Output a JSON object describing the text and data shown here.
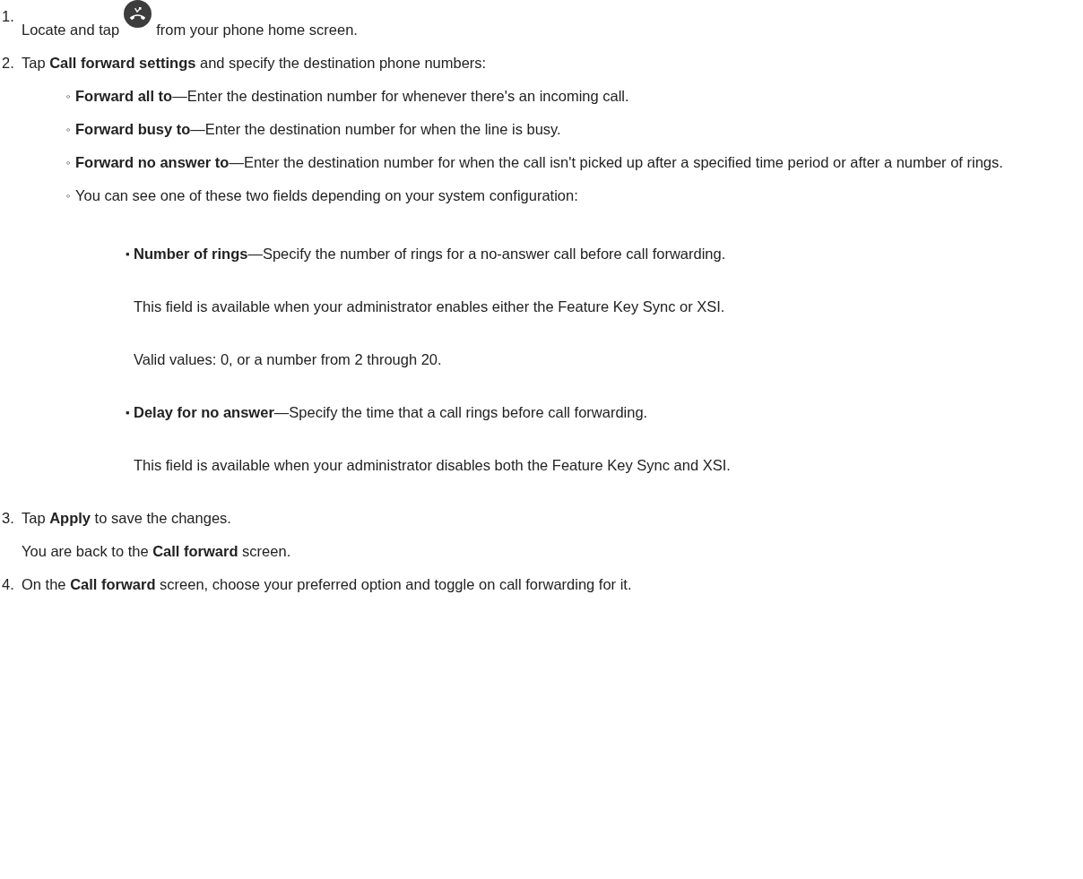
{
  "steps": [
    {
      "marker": "1.",
      "text_before": "Locate and tap",
      "text_after": "from your phone home screen."
    },
    {
      "marker": "2.",
      "text": "Tap **Call forward settings** and specify the destination phone numbers:",
      "items": [
        {
          "marker": "◦",
          "text": "**Forward all to**—Enter the destination number for whenever there's an incoming call."
        },
        {
          "marker": "◦",
          "text": "**Forward busy to**—Enter the destination number for when the line is busy."
        },
        {
          "marker": "◦",
          "text": "**Forward no answer to**—Enter the destination number for when the call isn't picked up after a specified time period or after a number of rings."
        },
        {
          "marker": "◦",
          "text": "You can see one of these two fields depending on your system configuration:",
          "items": [
            {
              "marker": "▪",
              "text": "**Number of rings**—Specify the number of rings for a no-answer call before call forwarding.",
              "notes": [
                "This field is available when your administrator enables either the Feature Key Sync or XSI.",
                "Valid values: 0, or a number from 2 through 20."
              ]
            },
            {
              "marker": "▪",
              "text": "**Delay for no answer**—Specify the time that a call rings before call forwarding.",
              "notes": [
                "This field is available when your administrator disables both the Feature Key Sync and XSI."
              ]
            }
          ]
        }
      ]
    },
    {
      "marker": "3.",
      "text": "Tap **Apply** to save the changes.",
      "notes": [
        "You are back to the **Call forward** screen."
      ]
    },
    {
      "marker": "4.",
      "text": "On the **Call forward** screen, choose your preferred option and toggle on call forwarding for it."
    }
  ]
}
